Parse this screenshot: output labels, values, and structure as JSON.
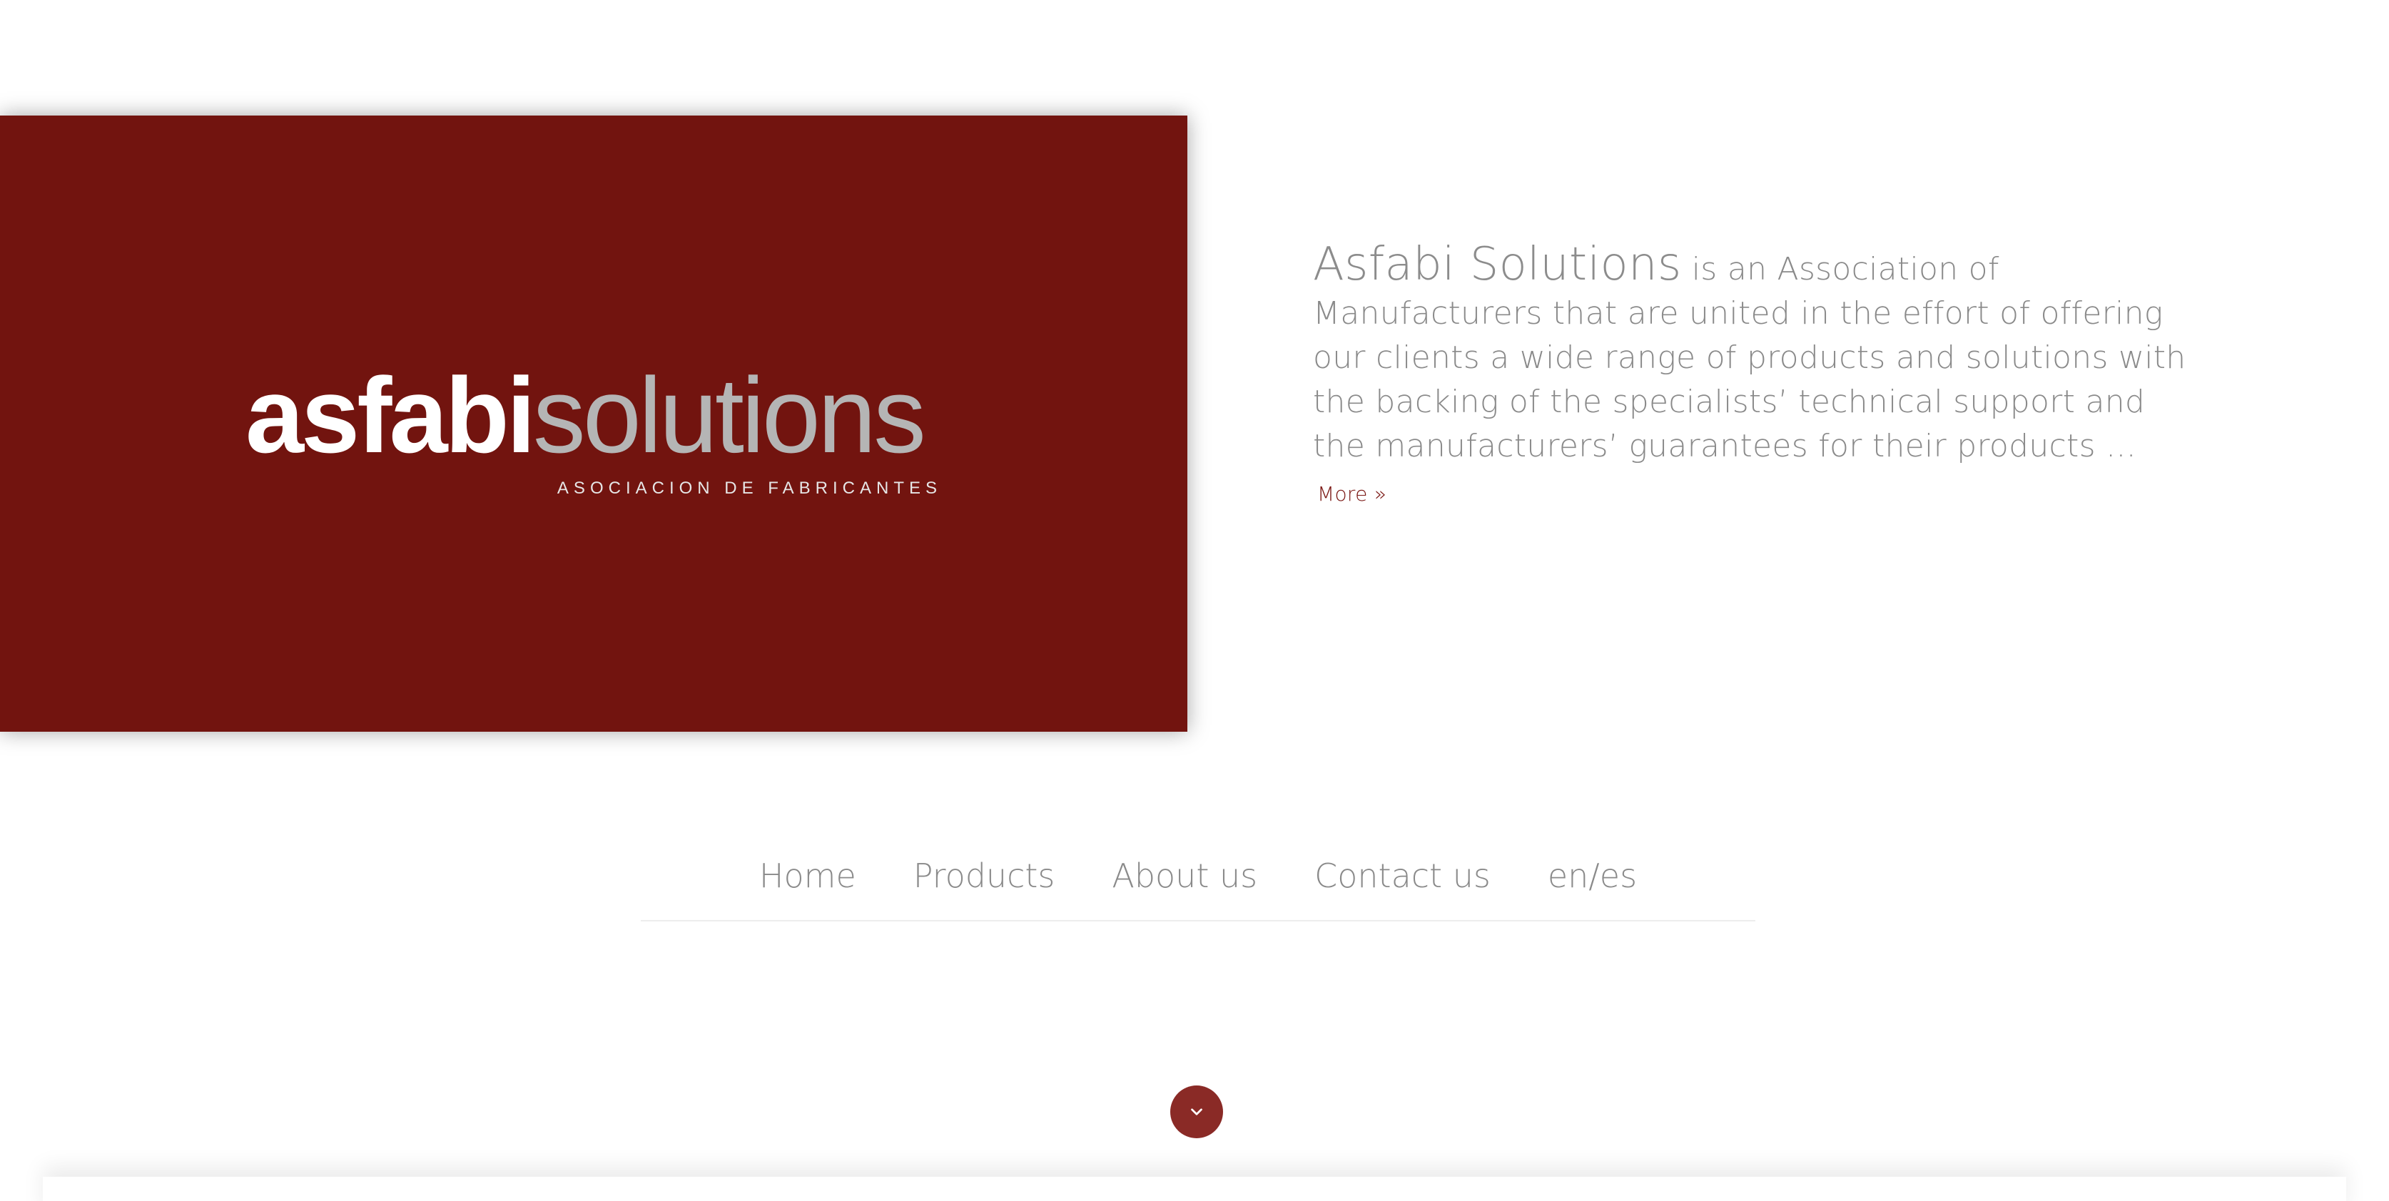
{
  "hero": {
    "background_color": "#72140f",
    "logo": {
      "word_part_1": "asfabi",
      "word_part_2": "solutions",
      "tagline": "ASOCIACION DE FABRICANTES",
      "color_part_1": "#ffffff",
      "color_part_2": "#b5b5b5"
    }
  },
  "intro": {
    "company_name": "Asfabi Solutions",
    "description": " is an Association of Manufacturers that are united in the effort of offering our clients a wide range of products and solutions with the backing of the specialists’ technical support and the manufacturers’ guarantees for their products ... ",
    "more_label": "More",
    "more_icon": "double-chevron-right-icon",
    "accent_color": "#7a1612"
  },
  "nav": {
    "items": [
      {
        "label": "Home"
      },
      {
        "label": "Products"
      },
      {
        "label": "About us"
      },
      {
        "label": "Contact us"
      },
      {
        "label": "en/es"
      }
    ]
  },
  "scroll_button": {
    "icon": "chevron-down-icon",
    "color": "#8a2a26"
  }
}
